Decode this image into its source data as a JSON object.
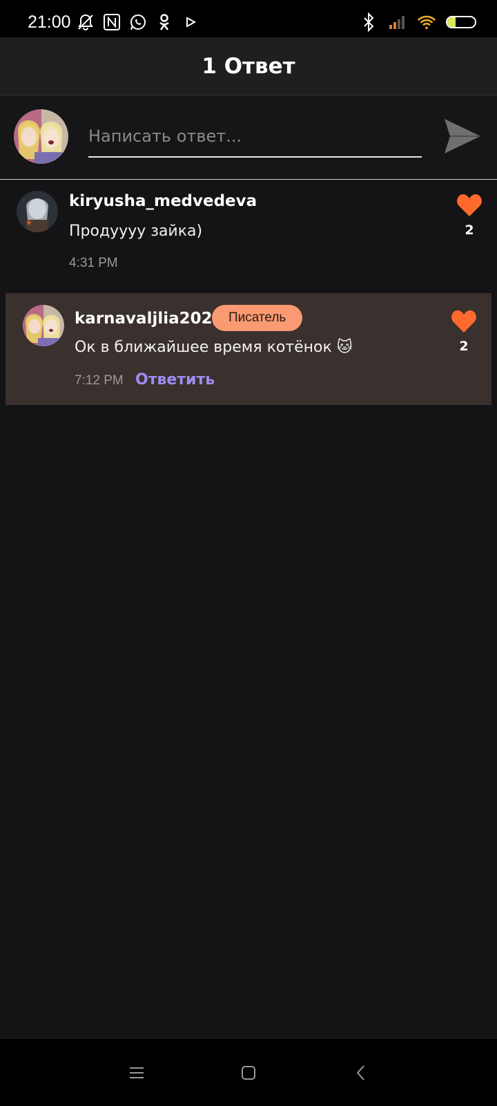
{
  "status_bar": {
    "time": "21:00",
    "icons_left": [
      "muted-bell-icon",
      "nfc-icon",
      "whatsapp-icon",
      "ok-icon",
      "play-icon"
    ],
    "icons_right": [
      "bluetooth-icon",
      "cellular-signal-icon",
      "wifi-icon",
      "battery-icon"
    ],
    "battery_percent": "30",
    "battery_level": 0.3
  },
  "header": {
    "title": "1 Ответ"
  },
  "reply_bar": {
    "placeholder": "Написать ответ..."
  },
  "comments": [
    {
      "username": "kiryusha_medvedeva",
      "text": "Продуууу зайка)",
      "time": "4:31 PM",
      "likes": "2"
    },
    {
      "username": "karnavaljlia2023",
      "badge": "Писатель",
      "text": "Ок в ближайшее время котёнок 🐱",
      "time": "7:12 PM",
      "reply_label": "Ответить",
      "likes": "2"
    }
  ],
  "colors": {
    "background": "#141316",
    "accent_heart": "#ff6a2c",
    "badge": "#fa9a72",
    "reply_link": "#9f8cf0",
    "highlight_row": "#3a302e"
  }
}
